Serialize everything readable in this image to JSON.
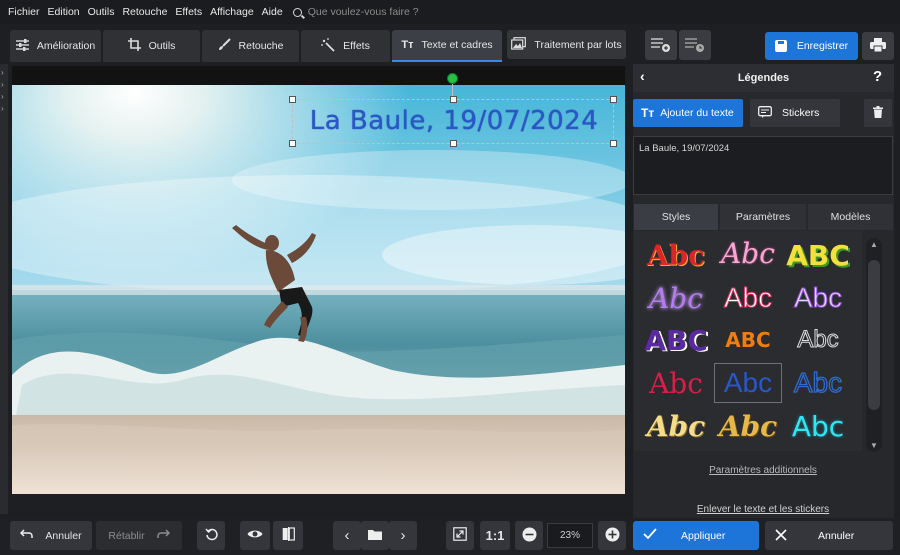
{
  "menu": [
    "Fichier",
    "Edition",
    "Outils",
    "Retouche",
    "Effets",
    "Affichage",
    "Aide"
  ],
  "search": {
    "placeholder": "Que voulez-vous faire ?"
  },
  "tabs": {
    "amelioration": "Amélioration",
    "outils": "Outils",
    "retouche": "Retouche",
    "effets": "Effets",
    "texte": "Texte et cadres",
    "lots": "Traitement par lots"
  },
  "save_label": "Enregistrer",
  "canvas": {
    "caption": "La Baule, 19/07/2024"
  },
  "panel": {
    "title": "Légendes",
    "help": "?",
    "add_text": "Ajouter du texte",
    "stickers": "Stickers",
    "text_value": "La Baule, 19/07/2024",
    "subtabs": [
      "Styles",
      "Paramètres",
      "Modèles"
    ],
    "styles": [
      "Abc",
      "Abc",
      "ABC",
      "Abc",
      "Abc",
      "Abc",
      "ABC",
      "ABC",
      "Abc",
      "Abc",
      "Abc",
      "Abc",
      "Abc",
      "Abc",
      "Abc"
    ],
    "more_params": "Paramètres additionnels",
    "remove": "Enlever le texte et les stickers"
  },
  "bottom": {
    "undo": "Annuler",
    "redo": "Rétablir",
    "ratio": "1:1",
    "zoom": "23%",
    "apply": "Appliquer",
    "cancel": "Annuler"
  },
  "colors": {
    "accent": "#1d74d9",
    "caption": "#2a56c8",
    "rotate_handle": "#27c14a"
  }
}
